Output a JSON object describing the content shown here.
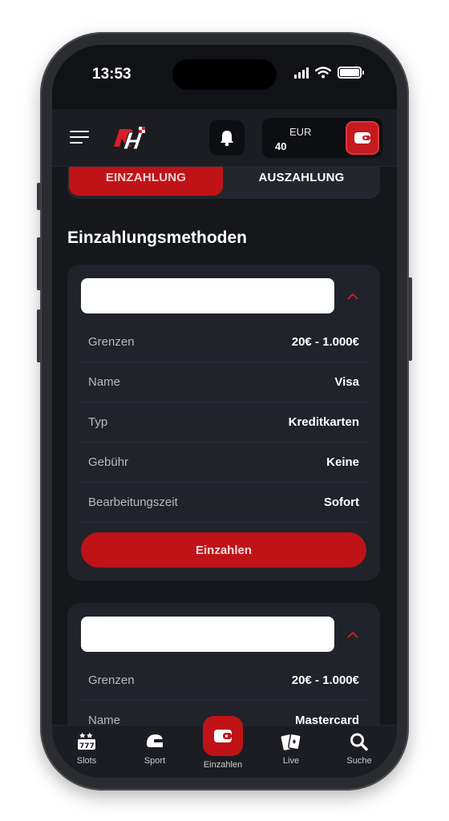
{
  "status_bar": {
    "time": "13:53"
  },
  "header": {
    "currency": "EUR",
    "balance": "40"
  },
  "tabs": [
    {
      "label": "EINZAHLUNG",
      "active": true
    },
    {
      "label": "AUSZAHLUNG",
      "active": false
    }
  ],
  "section_title": "Einzahlungsmethoden",
  "methods": [
    {
      "rows": [
        {
          "label": "Grenzen",
          "value": "20€ - 1.000€"
        },
        {
          "label": "Name",
          "value": "Visa"
        },
        {
          "label": "Typ",
          "value": "Kreditkarten"
        },
        {
          "label": "Gebühr",
          "value": "Keine"
        },
        {
          "label": "Bearbeitungszeit",
          "value": "Sofort"
        }
      ],
      "button_label": "Einzahlen"
    },
    {
      "rows": [
        {
          "label": "Grenzen",
          "value": "20€ - 1.000€"
        },
        {
          "label": "Name",
          "value": "Mastercard"
        }
      ]
    }
  ],
  "bottom_nav": [
    {
      "label": "Slots",
      "icon": "slots-icon"
    },
    {
      "label": "Sport",
      "icon": "sport-helmet-icon"
    },
    {
      "label": "Einzahlen",
      "icon": "wallet-icon"
    },
    {
      "label": "Live",
      "icon": "cards-icon"
    },
    {
      "label": "Suche",
      "icon": "search-icon"
    }
  ],
  "colors": {
    "accent": "#c01318",
    "background": "#15171b",
    "card": "#20232a"
  }
}
